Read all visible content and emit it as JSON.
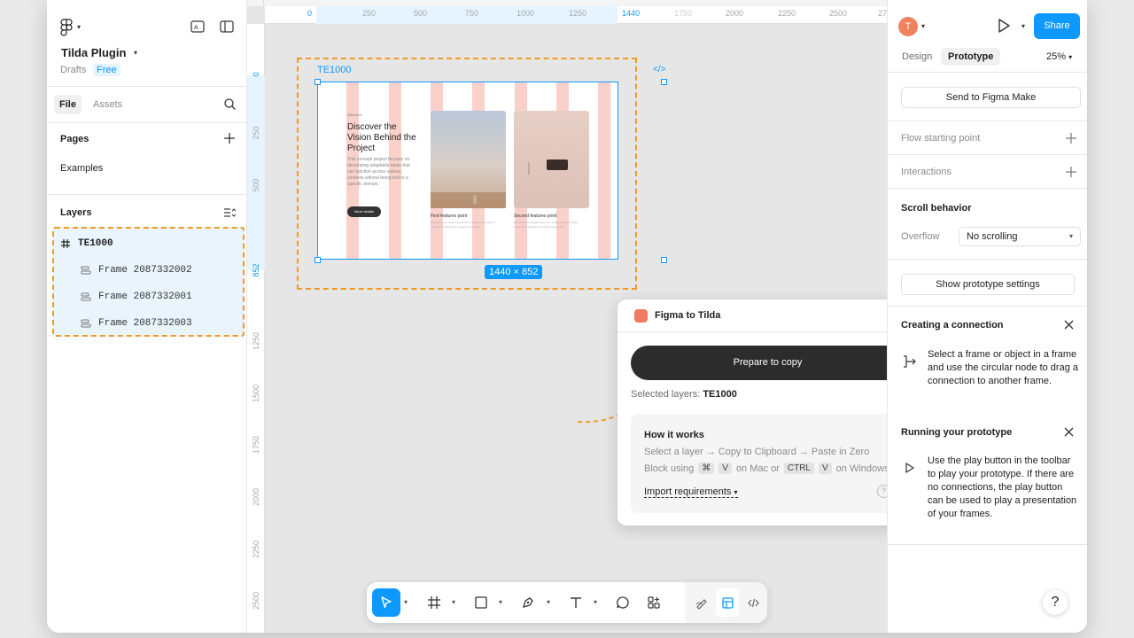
{
  "file": {
    "title": "Tilda Plugin",
    "location": "Drafts",
    "plan_badge": "Free"
  },
  "left_tabs": {
    "file": "File",
    "assets": "Assets"
  },
  "pages": {
    "header": "Pages",
    "items": [
      "Examples"
    ]
  },
  "layers": {
    "header": "Layers",
    "items": [
      {
        "name": "TE1000",
        "type": "frame"
      },
      {
        "name": "Frame 2087332002",
        "type": "autolayout"
      },
      {
        "name": "Frame 2087332001",
        "type": "autolayout"
      },
      {
        "name": "Frame 2087332003",
        "type": "autolayout"
      }
    ]
  },
  "ruler": {
    "h_ticks": [
      "0",
      "250",
      "500",
      "750",
      "1000",
      "1250",
      "1440",
      "1750",
      "2000",
      "2250",
      "2500",
      "27"
    ],
    "v_ticks": [
      "0",
      "250",
      "500",
      "852",
      "1250",
      "1500",
      "1750",
      "2000",
      "2250",
      "2500"
    ]
  },
  "frame": {
    "name": "TE1000",
    "dimensions": "1440 × 852",
    "content": {
      "small_label": "Welcome",
      "heading": "Discover the Vision Behind the Project",
      "paragraph": "This concept project focuses on developing adaptable ideas that can function across various contexts without being tied to a specific domain.",
      "button": "More details",
      "feature1": "First features point",
      "feature1_sub": "Examples of a simple layout for a project or description, these hints designed to support the project.",
      "feature2": "Second features point",
      "feature2_sub": "Examples of a simple layout for a project or description, these hints designed to support the project."
    }
  },
  "plugin": {
    "title": "Figma to Tilda",
    "prepare_button": "Prepare to copy",
    "selected_label": "Selected layers:",
    "selected_value": "TE1000",
    "how_title": "How it works",
    "how_line1": "Select a layer → Copy to Clipboard → Paste in Zero",
    "how_block": "Block using",
    "kbd_cmd": "⌘",
    "kbd_v": "V",
    "on_mac_or": "on Mac or",
    "kbd_ctrl": "CTRL",
    "on_windows": "on Windows",
    "import_requirements": "Import requirements",
    "help": "?"
  },
  "right": {
    "avatar_initial": "T",
    "share": "Share",
    "tabs": {
      "design": "Design",
      "prototype": "Prototype"
    },
    "zoom": "25%",
    "send_to_make": "Send to Figma Make",
    "flow_start": "Flow starting point",
    "interactions": "Interactions",
    "scroll_behavior": "Scroll behavior",
    "overflow_label": "Overflow",
    "overflow_value": "No scrolling",
    "show_proto_settings": "Show prototype settings",
    "creating_connection": "Creating a connection",
    "creating_connection_text": "Select a frame or object in a frame and use the circular node to drag a connection to another frame.",
    "running_prototype": "Running your prototype",
    "running_prototype_text": "Use the play button in the toolbar to play your prototype. If there are no connections, the play button can be used to play a presentation of your frames.",
    "help": "?"
  },
  "colors": {
    "accent": "#0d99ff",
    "highlight": "#f09a26",
    "plugin_logo": "#f07b5f"
  }
}
